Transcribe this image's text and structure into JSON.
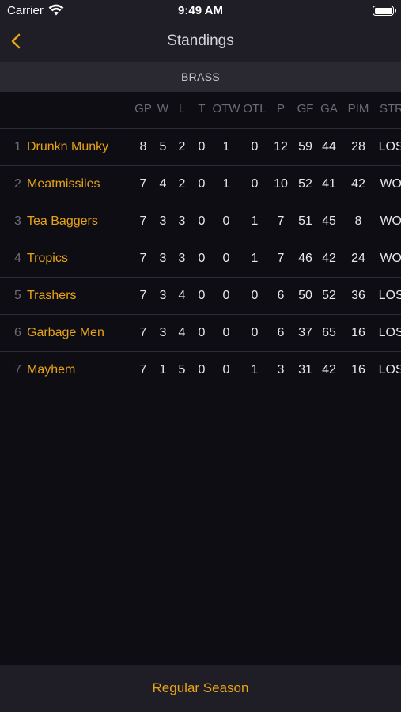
{
  "status_bar": {
    "carrier": "Carrier",
    "time": "9:49 AM"
  },
  "nav": {
    "title": "Standings"
  },
  "section": {
    "label": "BRASS"
  },
  "table": {
    "columns": [
      "GP",
      "W",
      "L",
      "T",
      "OTW",
      "OTL",
      "P",
      "GF",
      "GA",
      "PIM",
      "STRK"
    ],
    "rows": [
      {
        "rank": "1",
        "team": "Drunkn Munky",
        "stats": [
          "8",
          "5",
          "2",
          "0",
          "1",
          "0",
          "12",
          "59",
          "44",
          "28",
          "LOSS"
        ]
      },
      {
        "rank": "2",
        "team": "Meatmissiles",
        "stats": [
          "7",
          "4",
          "2",
          "0",
          "1",
          "0",
          "10",
          "52",
          "41",
          "42",
          "WON"
        ]
      },
      {
        "rank": "3",
        "team": "Tea Baggers",
        "stats": [
          "7",
          "3",
          "3",
          "0",
          "0",
          "1",
          "7",
          "51",
          "45",
          "8",
          "WON"
        ]
      },
      {
        "rank": "4",
        "team": "Tropics",
        "stats": [
          "7",
          "3",
          "3",
          "0",
          "0",
          "1",
          "7",
          "46",
          "42",
          "24",
          "WON"
        ]
      },
      {
        "rank": "5",
        "team": "Trashers",
        "stats": [
          "7",
          "3",
          "4",
          "0",
          "0",
          "0",
          "6",
          "50",
          "52",
          "36",
          "LOSS"
        ]
      },
      {
        "rank": "6",
        "team": "Garbage Men",
        "stats": [
          "7",
          "3",
          "4",
          "0",
          "0",
          "0",
          "6",
          "37",
          "65",
          "16",
          "LOSS"
        ]
      },
      {
        "rank": "7",
        "team": "Mayhem",
        "stats": [
          "7",
          "1",
          "5",
          "0",
          "0",
          "1",
          "3",
          "31",
          "42",
          "16",
          "LOSS"
        ]
      }
    ]
  },
  "footer": {
    "button_label": "Regular Season"
  },
  "colors": {
    "accent": "#e8a317",
    "background": "#0e0d14",
    "bar": "#1f1e26",
    "section": "#2a2931",
    "muted": "#6c6b74"
  },
  "icons": {
    "back": "chevron-left-icon",
    "wifi": "wifi-icon",
    "battery": "battery-icon"
  }
}
